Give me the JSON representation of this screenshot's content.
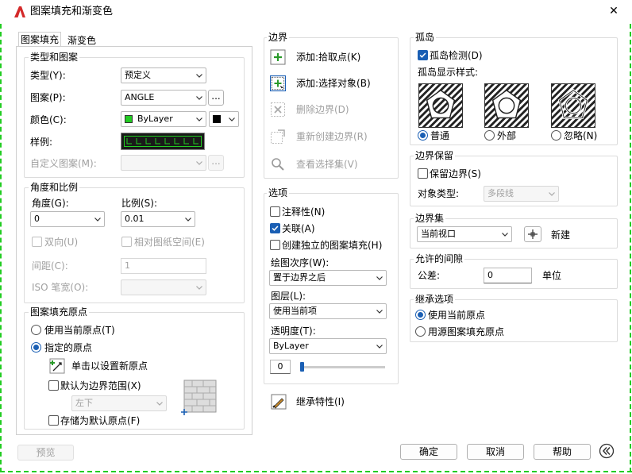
{
  "window": {
    "title": "图案填充和渐变色",
    "close": "✕"
  },
  "tabs": [
    "图案填充",
    "渐变色"
  ],
  "type_pattern": {
    "title": "类型和图案",
    "type_label": "类型(Y):",
    "type_value": "预定义",
    "pattern_label": "图案(P):",
    "pattern_value": "ANGLE",
    "pattern_btn": "...",
    "color_label": "颜色(C):",
    "color_value": "ByLayer",
    "color_swatch": "#22cc22",
    "sample_label": "样例:",
    "custom_label": "自定义图案(M):",
    "custom_btn": "..."
  },
  "angle_scale": {
    "title": "角度和比例",
    "angle_label": "角度(G):",
    "angle_value": "0",
    "scale_label": "比例(S):",
    "scale_value": "0.01",
    "double_label": "双向(U)",
    "relative_label": "相对图纸空间(E)",
    "spacing_label": "间距(C):",
    "spacing_value": "1",
    "iso_label": "ISO 笔宽(O):"
  },
  "origin": {
    "title": "图案填充原点",
    "current_label": "使用当前原点(T)",
    "specified_label": "指定的原点",
    "click_label": "单击以设置新原点",
    "default_extent_label": "默认为边界范围(X)",
    "position_value": "左下",
    "store_label": "存储为默认原点(F)"
  },
  "boundary": {
    "title": "边界",
    "add_pick": "添加:拾取点(K)",
    "add_select": "添加:选择对象(B)",
    "remove": "删除边界(D)",
    "recreate": "重新创建边界(R)",
    "view": "查看选择集(V)"
  },
  "options": {
    "title": "选项",
    "annotative": "注释性(N)",
    "associative": "关联(A)",
    "separate": "创建独立的图案填充(H)",
    "draw_order_label": "绘图次序(W):",
    "draw_order_value": "置于边界之后",
    "layer_label": "图层(L):",
    "layer_value": "使用当前项",
    "transparency_label": "透明度(T):",
    "transparency_value": "ByLayer",
    "transparency_amount": "0"
  },
  "inherit_btn": "继承特性(I)",
  "islands": {
    "title": "孤岛",
    "detect_label": "孤岛检测(D)",
    "style_label": "孤岛显示样式:",
    "normal": "普通",
    "outer": "外部",
    "ignore": "忽略(N)"
  },
  "retain": {
    "title": "边界保留",
    "retain_label": "保留边界(S)",
    "type_label": "对象类型:",
    "type_value": "多段线"
  },
  "boundary_set": {
    "title": "边界集",
    "value": "当前视口",
    "new_label": "新建"
  },
  "gap": {
    "title": "允许的间隙",
    "tolerance_label": "公差:",
    "tolerance_value": "0",
    "unit": "单位"
  },
  "inherit_options": {
    "title": "继承选项",
    "current": "使用当前原点",
    "source": "用源图案填充原点"
  },
  "footer": {
    "preview": "预览",
    "ok": "确定",
    "cancel": "取消",
    "help": "帮助"
  },
  "colors": {
    "accent": "#1a5fb4",
    "logo": "#d42a2a",
    "sample": "#22cc22"
  }
}
